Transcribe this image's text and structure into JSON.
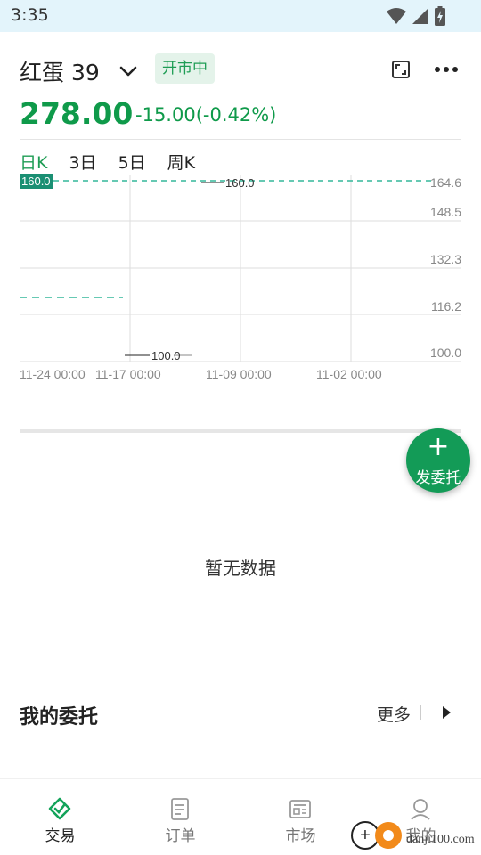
{
  "status_bar": {
    "time": "3:35"
  },
  "header": {
    "title": "红蛋 39",
    "market_status": "开市中",
    "price": "278.00",
    "change": "-15.00(-0.42%)"
  },
  "chart_tabs": [
    "日K",
    "3日",
    "5日",
    "周K"
  ],
  "chart_data": {
    "type": "line",
    "y_ticks": [
      "164.6",
      "148.5",
      "132.3",
      "116.2",
      "100.0"
    ],
    "x_labels": [
      "11-24 00:00",
      "11-17 00:00",
      "11-09 00:00",
      "11-02 00:00"
    ],
    "ylim": [
      100.0,
      164.6
    ],
    "current_value_label": "160.0",
    "high_label": "160.0",
    "low_label": "100.0",
    "reference_lines": [
      {
        "value": 164.6,
        "color": "#33b79a"
      },
      {
        "value": 120.6,
        "color": "#33b79a"
      }
    ],
    "grid": true
  },
  "fab": {
    "icon": "plus-icon",
    "label": "发委托"
  },
  "empty_state": "暂无数据",
  "my_orders": {
    "title": "我的委托",
    "more": "更多"
  },
  "bottom_nav": [
    {
      "label": "交易",
      "icon": "trade-icon",
      "active": true
    },
    {
      "label": "订单",
      "icon": "order-icon",
      "active": false
    },
    {
      "label": "市场",
      "icon": "market-icon",
      "active": false
    },
    {
      "label": "我的",
      "icon": "profile-icon",
      "active": false
    }
  ],
  "watermark": {
    "text": "danji100.com"
  },
  "colors": {
    "accent": "#1f9d55",
    "price": "#0f9a4a",
    "status_bar": "#e3f4fb"
  }
}
